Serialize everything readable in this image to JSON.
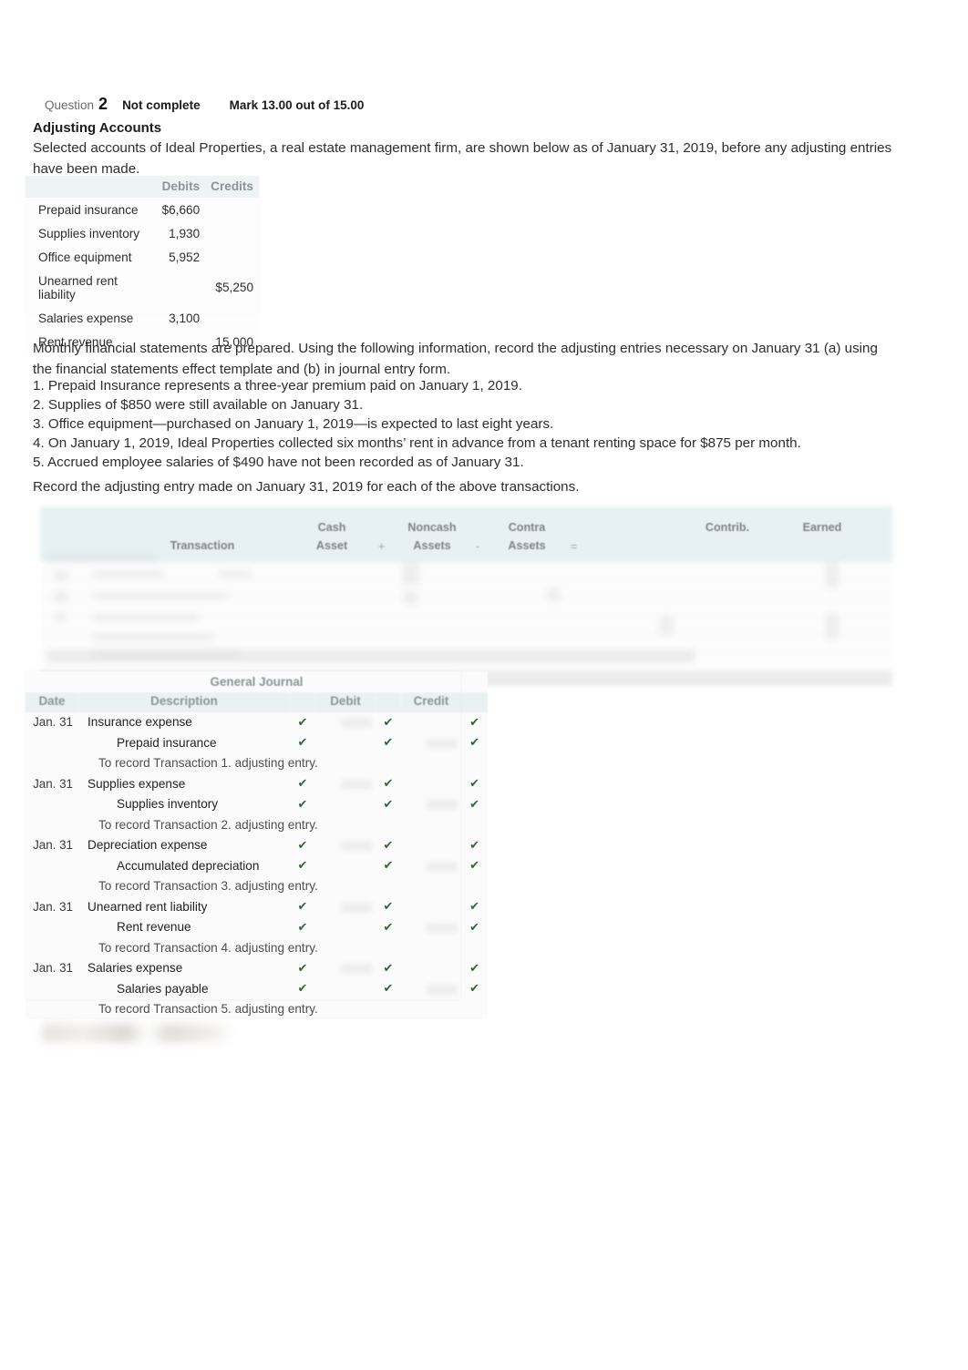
{
  "question": {
    "label": "Question",
    "number": "2",
    "state": "Not complete",
    "mark": "Mark 13.00 out of 15.00"
  },
  "title": "Adjusting Accounts",
  "intro": "Selected accounts of Ideal Properties, a real estate management firm, are shown below as of January 31, 2019, before any adjusting entries have been made.",
  "trial_balance": {
    "headers": [
      "",
      "Debits",
      "Credits"
    ],
    "rows": [
      {
        "account": "Prepaid insurance",
        "debit": "$6,660",
        "credit": ""
      },
      {
        "account": "Supplies inventory",
        "debit": "1,930",
        "credit": ""
      },
      {
        "account": "Office equipment",
        "debit": "5,952",
        "credit": ""
      },
      {
        "account": "Unearned rent liability",
        "debit": "",
        "credit": "$5,250"
      },
      {
        "account": "Salaries expense",
        "debit": "3,100",
        "credit": ""
      },
      {
        "account": "Rent revenue",
        "debit": "",
        "credit": "15,000"
      }
    ]
  },
  "para2": "Monthly financial statements are prepared. Using the following information, record the adjusting entries necessary on January 31 (a) using the financial statements effect template and (b) in journal entry form.",
  "numbered_list": [
    "1. Prepaid Insurance represents a three-year premium paid on January 1, 2019.",
    "2. Supplies of $850 were still available on January 31.",
    "3. Office equipment—purchased on January 1, 2019—is expected to last eight years.",
    "4. On January 1, 2019, Ideal Properties collected six months’ rent in advance from a tenant renting space for $875 per month.",
    "5. Accrued employee salaries of $490 have not been recorded as of January 31."
  ],
  "para3": "Record the adjusting entry made on January 31, 2019 for each of the above transactions.",
  "effects_template": {
    "headers": {
      "transaction": "Transaction",
      "cash_asset_line1": "Cash",
      "cash_asset_line2": "Asset",
      "plus": "+",
      "noncash_line1": "Noncash",
      "noncash_line2": "Assets",
      "minus": "-",
      "contra_line1": "Contra",
      "contra_line2": "Assets",
      "equals": "=",
      "contrib": "Contrib.",
      "earned": "Earned"
    }
  },
  "general_journal": {
    "title": "General Journal",
    "headers": {
      "date": "Date",
      "description": "Description",
      "debit": "Debit",
      "credit": "Credit"
    },
    "check_mark": "✔",
    "entries": [
      {
        "date": "Jan. 31",
        "debit_account": "Insurance expense",
        "credit_account": "Prepaid insurance",
        "memo": "To record Transaction 1. adjusting entry."
      },
      {
        "date": "Jan. 31",
        "debit_account": "Supplies expense",
        "credit_account": "Supplies inventory",
        "memo": "To record Transaction 2. adjusting entry."
      },
      {
        "date": "Jan. 31",
        "debit_account": "Depreciation expense",
        "credit_account": "Accumulated depreciation",
        "memo": "To record Transaction 3. adjusting entry."
      },
      {
        "date": "Jan. 31",
        "debit_account": "Unearned rent liability",
        "credit_account": "Rent revenue",
        "memo": "To record Transaction 4. adjusting entry."
      },
      {
        "date": "Jan. 31",
        "debit_account": "Salaries expense",
        "credit_account": "Salaries payable",
        "memo": "To record Transaction 5. adjusting entry."
      }
    ]
  },
  "colors": {
    "table_header_bg": "#e9f1f3",
    "table_header_text": "#8d9496",
    "check_green": "#2e6b35",
    "body_text": "#2e2e2e"
  }
}
